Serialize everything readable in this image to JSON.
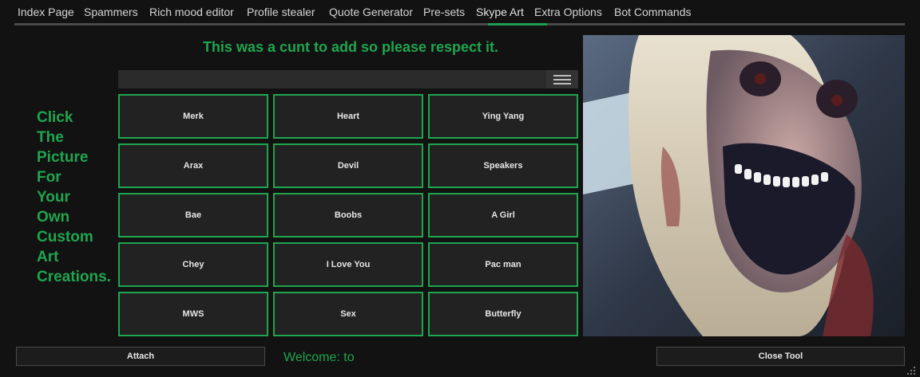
{
  "tabs": [
    {
      "label": "Index Page"
    },
    {
      "label": "Spammers"
    },
    {
      "label": "Rich mood editor"
    },
    {
      "label": "Profile stealer"
    },
    {
      "label": "Quote Generator"
    },
    {
      "label": "Pre-sets"
    },
    {
      "label": "Skype Art",
      "active": true
    },
    {
      "label": "Extra Options"
    },
    {
      "label": "Bot Commands"
    }
  ],
  "headline": "This was a cunt to add so please respect it.",
  "instruction_words": [
    "Click",
    "The",
    "Picture",
    "For",
    "Your",
    "Own",
    "Custom",
    "Art",
    "Creations."
  ],
  "search": {
    "value": "",
    "placeholder": ""
  },
  "art_buttons": [
    [
      "Merk",
      "Heart",
      "Ying Yang"
    ],
    [
      "Arax",
      "Devil",
      "Speakers"
    ],
    [
      "Bae",
      "Boobs",
      "A Girl"
    ],
    [
      "Chey",
      "I Love You",
      "Pac man"
    ],
    [
      "MWS",
      "Sex",
      "Butterfly"
    ]
  ],
  "bottom": {
    "attach_label": "Attach",
    "welcome_text": "Welcome: to",
    "close_label": "Close Tool"
  },
  "colors": {
    "accent": "#1fa54f",
    "background": "#121212",
    "button_bg": "#222222"
  },
  "icons": {
    "menu": "hamburger-menu-icon",
    "grip": "resize-grip-icon"
  }
}
